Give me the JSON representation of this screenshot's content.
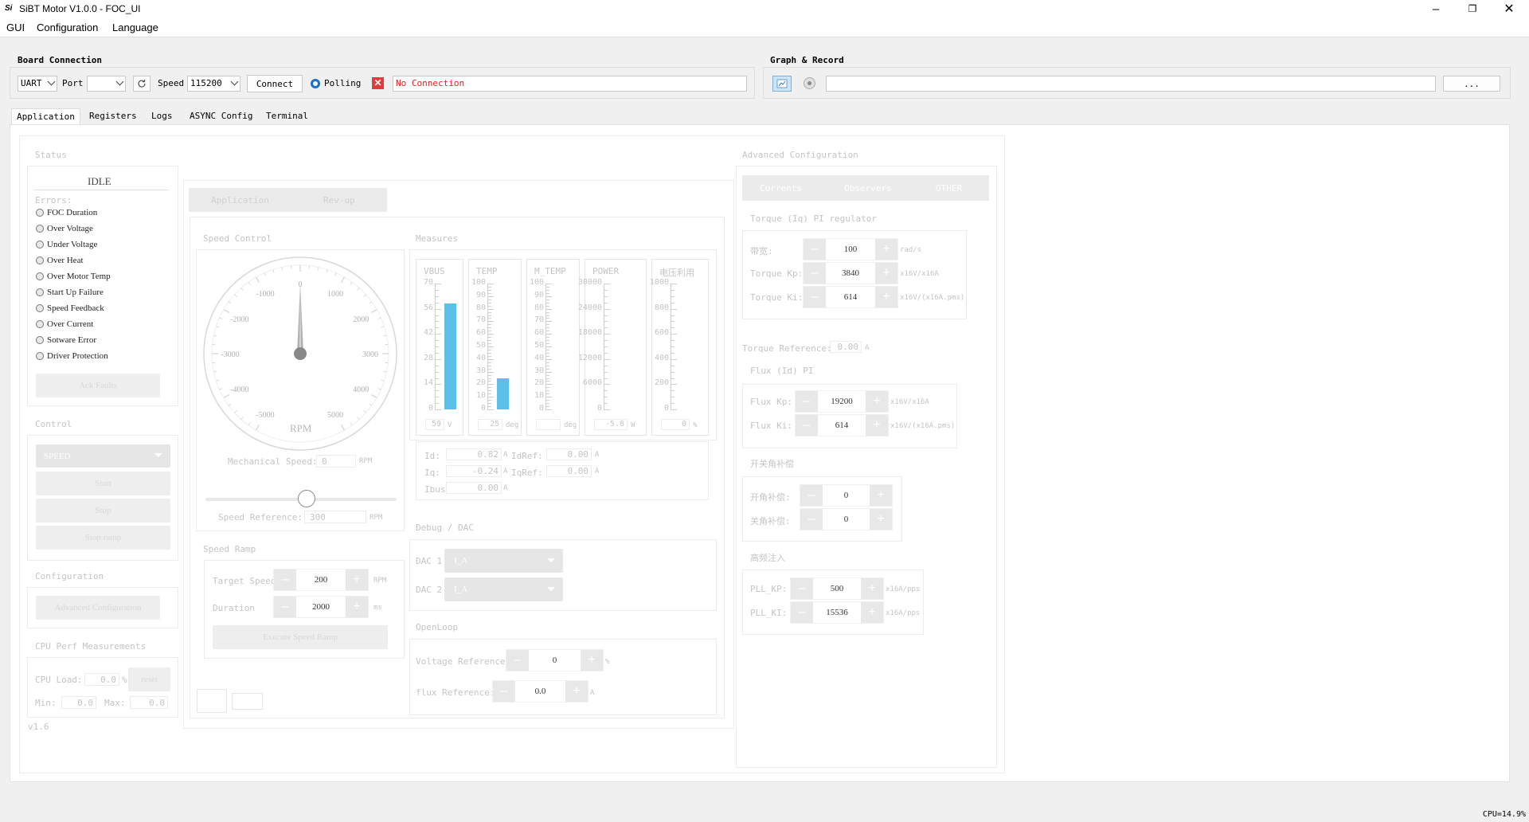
{
  "window": {
    "title": "SiBT Motor V1.0.0 - FOC_UI"
  },
  "menu": [
    "GUI",
    "Configuration",
    "Language"
  ],
  "board_connection": {
    "title": "Board Connection",
    "interface": "UART",
    "port_label": "Port",
    "port_value": "",
    "speed_label": "Speed",
    "speed_value": "115200",
    "connect_label": "Connect",
    "polling_label": "Polling",
    "status_text": "No Connection"
  },
  "graph_record": {
    "title": "Graph & Record",
    "browse_label": "..."
  },
  "tabs": [
    "Application",
    "Registers",
    "Logs",
    "ASYNC Config",
    "Terminal"
  ],
  "status": {
    "title": "Status",
    "state": "IDLE",
    "errors_label": "Errors:",
    "errors": [
      "FOC Duration",
      "Over Voltage",
      "Under Voltage",
      "Over Heat",
      "Over Motor Temp",
      "Start Up Failure",
      "Speed Feedback",
      "Over Current",
      "Sotware Error",
      "Driver Protection"
    ],
    "ack_label": "Ack Faults"
  },
  "control": {
    "title": "Control",
    "mode": "SPEED",
    "start_label": "Start",
    "stop_label": "Stop",
    "stop_ramp_label": "Stop ramp"
  },
  "configuration": {
    "title": "Configuration",
    "advanced_label": "Advanced Configuration"
  },
  "cpu_perf": {
    "title": "CPU Perf Measurements",
    "load_label": "CPU Load:",
    "load_value": "0.0",
    "load_unit": "%",
    "reset_label": "reset",
    "min_label": "Min:",
    "min_value": "0.0",
    "max_label": "Max:",
    "max_value": "0.0"
  },
  "version": "v1.6",
  "subtabs": [
    "Application",
    "Rev-up"
  ],
  "speed_control": {
    "title": "Speed Control",
    "gauge_unit": "RPM",
    "gauge_ticks": [
      "-5000",
      "-4000",
      "-3000",
      "-2000",
      "-1000",
      "0",
      "1000",
      "2000",
      "3000",
      "4000",
      "5000"
    ],
    "mech_speed_label": "Mechanical Speed:",
    "mech_speed_value": "0",
    "mech_speed_unit": "RPM",
    "speed_ref_label": "Speed Reference:",
    "speed_ref_value": "300",
    "speed_ref_unit": "RPM"
  },
  "speed_ramp": {
    "title": "Speed Ramp",
    "target_label": "Target Speed",
    "target_value": "200",
    "target_unit": "RPM",
    "duration_label": "Duration",
    "duration_value": "2000",
    "duration_unit": "ms",
    "execute_label": "Execute Speed Ramp"
  },
  "measures": {
    "title": "Measures",
    "gauges": [
      {
        "name": "VBUS",
        "ticks": [
          "70",
          "56",
          "42",
          "28",
          "14",
          "0"
        ],
        "value": "59",
        "unit": "V",
        "fill": 0.84
      },
      {
        "name": "TEMP",
        "ticks": [
          "100",
          "90",
          "80",
          "70",
          "60",
          "50",
          "40",
          "30",
          "20",
          "10",
          "0"
        ],
        "value": "25",
        "unit": "deg",
        "fill": 0.25
      },
      {
        "name": "M_TEMP",
        "ticks": [
          "100",
          "90",
          "80",
          "70",
          "60",
          "50",
          "40",
          "30",
          "20",
          "10",
          "0"
        ],
        "value": "",
        "unit": "deg",
        "fill": 0
      },
      {
        "name": "POWER",
        "ticks": [
          "30000",
          "24000",
          "18000",
          "12000",
          "6000",
          "0"
        ],
        "value": "-5.8",
        "unit": "W",
        "fill": 0
      },
      {
        "name": "电压利用",
        "ticks": [
          "1000",
          "800",
          "600",
          "400",
          "200",
          "0"
        ],
        "value": "0",
        "unit": "%",
        "fill": 0
      }
    ],
    "id_label": "Id:",
    "id_value": "0.82",
    "id_unit": "A",
    "idref_label": "IdRef:",
    "idref_value": "0.00",
    "idref_unit": "A",
    "iq_label": "Iq:",
    "iq_value": "-0.24",
    "iq_unit": "A",
    "iqref_label": "IqRef:",
    "iqref_value": "0.00",
    "iqref_unit": "A",
    "ibus_label": "Ibus:",
    "ibus_value": "0.00",
    "ibus_unit": "A"
  },
  "debug_dac": {
    "title": "Debug / DAC",
    "dac1_label": "DAC 1",
    "dac1_value": "I_A",
    "dac2_label": "DAC 2",
    "dac2_value": "I_A"
  },
  "openloop": {
    "title": "OpenLoop",
    "voltage_label": "Voltage Reference:",
    "voltage_value": "0",
    "voltage_unit": "%",
    "flux_label": "flux Reference:",
    "flux_value": "0.0",
    "flux_unit": "A"
  },
  "advanced": {
    "title": "Advanced Configuration",
    "tabs": [
      "Currents",
      "Observers",
      "OTHER"
    ],
    "torque_pi": {
      "title": "Torque (Iq) PI regulator",
      "rows": [
        {
          "label": "带宽:",
          "value": "100",
          "unit": "rad/s"
        },
        {
          "label": "Torque Kp:",
          "value": "3840",
          "unit": "x16V/x16A"
        },
        {
          "label": "Torque Ki:",
          "value": "614",
          "unit": "x16V/(x16A.pms)"
        }
      ]
    },
    "torque_ref_label": "Torque Reference:",
    "torque_ref_value": "0.00",
    "torque_ref_unit": "A",
    "flux_pi": {
      "title": "Flux (Id) PI",
      "rows": [
        {
          "label": "Flux Kp:",
          "value": "19200",
          "unit": "x16V/x16A"
        },
        {
          "label": "Flux Ki:",
          "value": "614",
          "unit": "x16V/(x16A.pms)"
        }
      ]
    },
    "switch_comp": {
      "title": "开关角补偿",
      "rows": [
        {
          "label": "开角补偿:",
          "value": "0"
        },
        {
          "label": "关角补偿:",
          "value": "0"
        }
      ]
    },
    "hf_inject": {
      "title": "高频注入",
      "rows": [
        {
          "label": "PLL_KP:",
          "value": "500",
          "unit": "x16A/pps"
        },
        {
          "label": "PLL_KI:",
          "value": "15536",
          "unit": "x16A/pps"
        }
      ]
    }
  },
  "statusbar": {
    "cpu": "CPU=14.9%"
  }
}
